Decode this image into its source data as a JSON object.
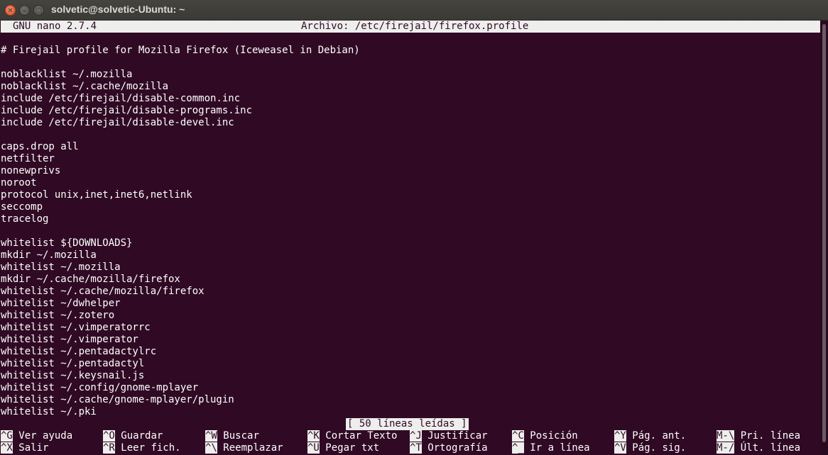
{
  "window": {
    "title": "solvetic@solvetic-Ubuntu: ~",
    "close_glyph": "✕",
    "minimize_glyph": "–",
    "maximize_glyph": "□"
  },
  "nano": {
    "version": "GNU nano 2.7.4",
    "file_label": "Archivo: /etc/firejail/firefox.profile",
    "status": "[ 50 líneas leídas ]"
  },
  "content_lines": [
    "# Firejail profile for Mozilla Firefox (Iceweasel in Debian)",
    "",
    "noblacklist ~/.mozilla",
    "noblacklist ~/.cache/mozilla",
    "include /etc/firejail/disable-common.inc",
    "include /etc/firejail/disable-programs.inc",
    "include /etc/firejail/disable-devel.inc",
    "",
    "caps.drop all",
    "netfilter",
    "nonewprivs",
    "noroot",
    "protocol unix,inet,inet6,netlink",
    "seccomp",
    "tracelog",
    "",
    "whitelist ${DOWNLOADS}",
    "mkdir ~/.mozilla",
    "whitelist ~/.mozilla",
    "mkdir ~/.cache/mozilla/firefox",
    "whitelist ~/.cache/mozilla/firefox",
    "whitelist ~/dwhelper",
    "whitelist ~/.zotero",
    "whitelist ~/.vimperatorrc",
    "whitelist ~/.vimperator",
    "whitelist ~/.pentadactylrc",
    "whitelist ~/.pentadactyl",
    "whitelist ~/.keysnail.js",
    "whitelist ~/.config/gnome-mplayer",
    "whitelist ~/.cache/gnome-mplayer/plugin",
    "whitelist ~/.pki"
  ],
  "shortcuts_row1": [
    {
      "key": "^G",
      "label": "Ver ayuda"
    },
    {
      "key": "^O",
      "label": "Guardar"
    },
    {
      "key": "^W",
      "label": "Buscar"
    },
    {
      "key": "^K",
      "label": "Cortar Texto"
    },
    {
      "key": "^J",
      "label": "Justificar"
    },
    {
      "key": "^C",
      "label": "Posición"
    },
    {
      "key": "^Y",
      "label": "Pág. ant."
    },
    {
      "key": "M-\\",
      "label": "Pri. línea"
    }
  ],
  "shortcuts_row2": [
    {
      "key": "^X",
      "label": "Salir"
    },
    {
      "key": "^R",
      "label": "Leer fich."
    },
    {
      "key": "^\\",
      "label": "Reemplazar"
    },
    {
      "key": "^U",
      "label": "Pegar txt"
    },
    {
      "key": "^T",
      "label": "Ortografía"
    },
    {
      "key": "^_",
      "label": "Ir a línea"
    },
    {
      "key": "^V",
      "label": "Pág. sig."
    },
    {
      "key": "M-/",
      "label": "Últ. línea"
    }
  ],
  "colors": {
    "terminal_bg": "#300a24",
    "terminal_fg": "#ffffff",
    "highlight_bg": "#eeeeec",
    "titlebar_bg": "#3c3b37",
    "close_button": "#e0512b"
  }
}
